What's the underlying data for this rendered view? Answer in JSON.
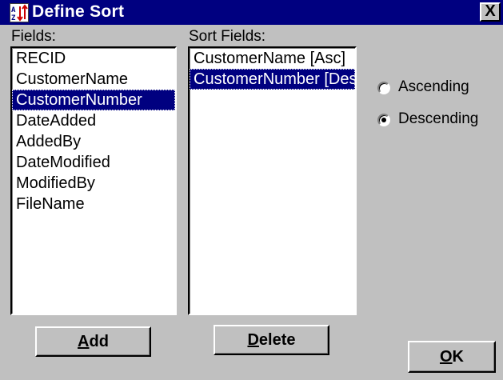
{
  "window": {
    "title": "Define Sort",
    "close_glyph": "X",
    "icon": "sort-az-icon"
  },
  "fields_panel": {
    "label": "Fields:",
    "items": [
      {
        "label": "RECID"
      },
      {
        "label": "CustomerName"
      },
      {
        "label": "CustomerNumber",
        "selected": true
      },
      {
        "label": "DateAdded"
      },
      {
        "label": "AddedBy"
      },
      {
        "label": "DateModified"
      },
      {
        "label": "ModifiedBy"
      },
      {
        "label": "FileName"
      }
    ],
    "add_button": {
      "accel": "A",
      "rest": "dd"
    }
  },
  "sort_panel": {
    "label": "Sort Fields:",
    "items": [
      {
        "label": "CustomerName [Asc]"
      },
      {
        "label": "CustomerNumber [Des]",
        "selected": true
      }
    ],
    "delete_button": {
      "accel": "D",
      "rest": "elete"
    }
  },
  "order": {
    "options": [
      {
        "label": "Ascending",
        "checked": false
      },
      {
        "label": "Descending",
        "checked": true
      }
    ]
  },
  "ok_button": {
    "accel": "O",
    "rest": "K"
  },
  "colors": {
    "title_bar": "#000080",
    "dialog_bg": "#c0c0c0",
    "selection": "#000080"
  }
}
